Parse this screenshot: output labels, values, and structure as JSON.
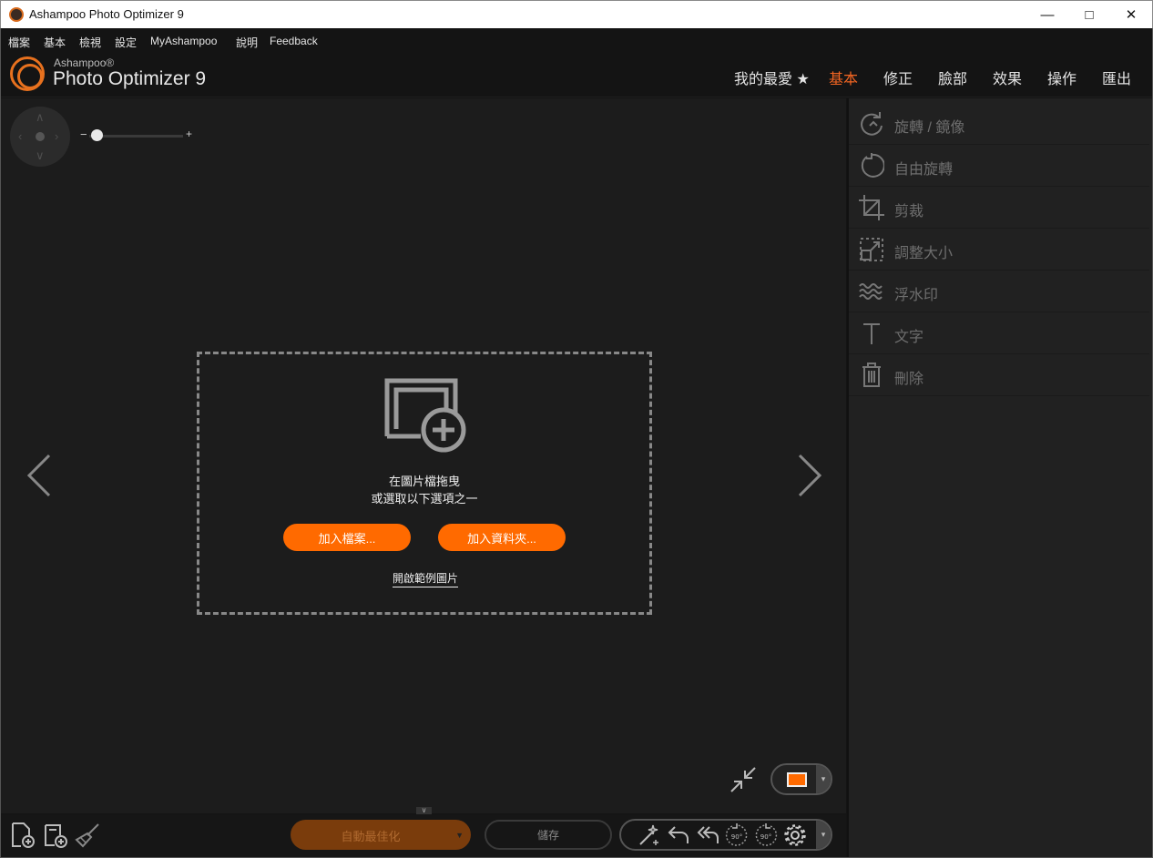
{
  "window": {
    "title": "Ashampoo Photo Optimizer 9"
  },
  "menu": [
    "檔案",
    "基本",
    "檢視",
    "設定",
    "MyAshampoo",
    "說明",
    "Feedback"
  ],
  "brand": {
    "small": "Ashampoo®",
    "big": "Photo Optimizer 9"
  },
  "nav": [
    {
      "label": "我的最愛 ★",
      "active": false
    },
    {
      "label": "基本",
      "active": true
    },
    {
      "label": "修正",
      "active": false
    },
    {
      "label": "臉部",
      "active": false
    },
    {
      "label": "效果",
      "active": false
    },
    {
      "label": "操作",
      "active": false
    },
    {
      "label": "匯出",
      "active": false
    }
  ],
  "zoom": {
    "minus": "−",
    "plus": "+",
    "level": 0.08
  },
  "dropzone": {
    "line1": "在圖片檔拖曳",
    "line2": "或選取以下選項之一",
    "add_files": "加入檔案...",
    "add_folder": "加入資料夾...",
    "sample_link": "開啟範例圖片"
  },
  "tools": [
    {
      "label": "旋轉 / 鏡像",
      "icon": "rotate-mirror-icon"
    },
    {
      "label": "自由旋轉",
      "icon": "free-rotate-icon"
    },
    {
      "label": "剪裁",
      "icon": "crop-icon"
    },
    {
      "label": "調整大小",
      "icon": "resize-icon"
    },
    {
      "label": "浮水印",
      "icon": "watermark-icon"
    },
    {
      "label": "文字",
      "icon": "text-icon"
    },
    {
      "label": "刪除",
      "icon": "trash-icon"
    }
  ],
  "bottom": {
    "auto_optimize": "自動最佳化",
    "save": "儲存",
    "rotate_left_badge": "90°",
    "rotate_right_badge": "90°"
  },
  "colors": {
    "accent": "#f26522",
    "button": "#ff6a00",
    "panel": "#212121"
  }
}
